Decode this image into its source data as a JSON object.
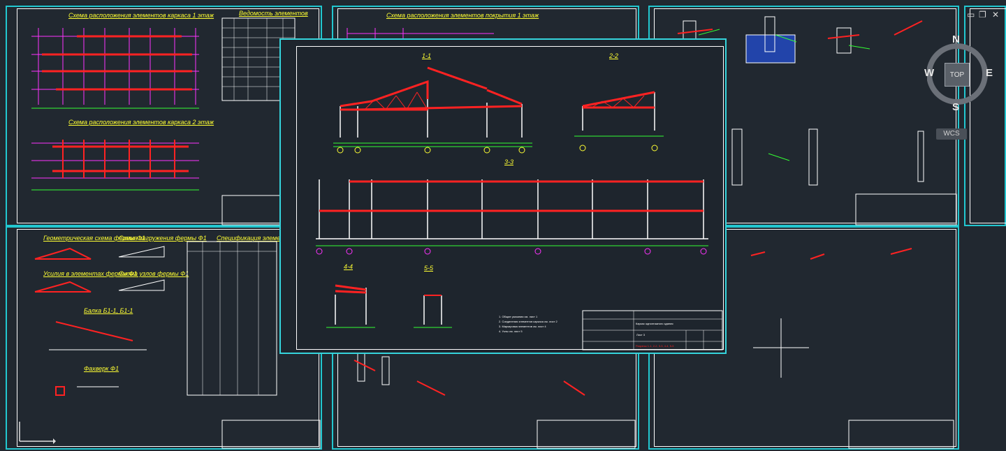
{
  "viewcube": {
    "north": "N",
    "south": "S",
    "east": "E",
    "west": "W",
    "top_button": "TOP",
    "wcs_label": "WCS"
  },
  "window_controls": {
    "minimize": "▭",
    "restore": "❐",
    "close": "✕"
  },
  "sheets": {
    "s1": {
      "title1": "Схема расположения элементов каркаса 1 этаж",
      "title2": "Схема расположения элементов каркаса 2 этаж",
      "table_title": "Ведомость элементов"
    },
    "s2": {
      "title": "Схема расположения элементов покрытия 1 этаж"
    },
    "s4": {
      "title1": "Геометрическая схема фермы Ф1",
      "title2": "Схема загружения фермы Ф1",
      "title3": "Усилия в элементах фермы Ф1",
      "title4": "Схема узлов фермы Ф1",
      "title5": "Балка Б1-1, Б1-1",
      "title6": "Фахверк Ф1",
      "table_title": "Спецификация элементов фер"
    }
  },
  "front_sheet": {
    "sections": [
      "1-1",
      "2-2",
      "3-3",
      "4-4",
      "5-5"
    ],
    "notes": [
      "1. Общие указания см. лист 1",
      "2. Соединения элементов каркаса см. лист 2",
      "3. Маркировка элементов см. лист 4",
      "4. Узлы см. лист 5"
    ],
    "stamp": {
      "title": "Каркас одноэтажного здания",
      "subtitle": "Разрезы 1-1, 2-2, 3-3, 4-4, 5-5",
      "sheet": "Лист 3"
    }
  }
}
